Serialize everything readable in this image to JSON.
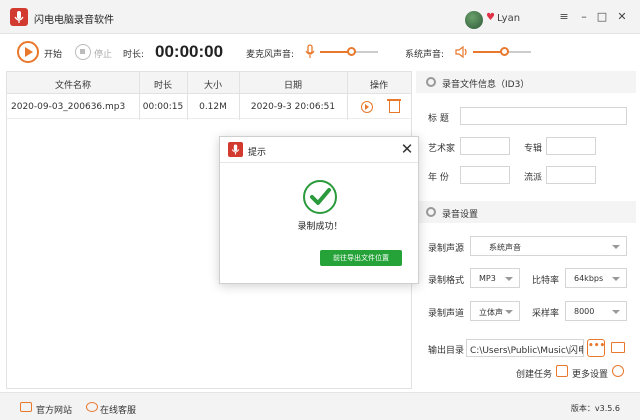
{
  "app": {
    "title": "闪电电脑录音软件",
    "user": "Lyan"
  },
  "window_controls": {
    "menu": "≡",
    "minimize": "–",
    "maximize": "□",
    "close": "✕"
  },
  "toolbar": {
    "start_label": "开始",
    "stop_label": "停止",
    "duration_label": "时长:",
    "duration_value": "00:00:00",
    "mic_label": "麦克风声音:",
    "system_label": "系统声音:",
    "mic_level": 0.55,
    "system_level": 0.55
  },
  "table": {
    "headers": [
      "文件名称",
      "时长",
      "大小",
      "日期",
      "操作"
    ],
    "rows": [
      {
        "name": "2020-09-03_200636.mp3",
        "duration": "00:00:15",
        "size": "0.12M",
        "date": "2020-9-3  20:06:51"
      }
    ]
  },
  "id3": {
    "section_title": "录音文件信息（ID3）",
    "title_label": "标  题",
    "artist_label": "艺术家",
    "album_label": "专辑",
    "year_label": "年  份",
    "genre_label": "流派"
  },
  "settings": {
    "section_title": "录音设置",
    "source_label": "录制声源",
    "source_value": "系统声音",
    "format_label": "录制格式",
    "format_value": "MP3",
    "bitrate_label": "比特率",
    "bitrate_value": "64kbps",
    "channel_label": "录制声道",
    "channel_value": "立体声",
    "samplerate_label": "采样率",
    "samplerate_value": "8000",
    "output_label": "输出目录",
    "output_value": "C:\\Users\\Public\\Music\\闪电",
    "browse_label": "•••",
    "create_task_label": "创建任务",
    "more_settings_label": "更多设置"
  },
  "footer": {
    "website_label": "官方网站",
    "service_label": "在线客服",
    "version": "版本：v3.5.6"
  },
  "dialog": {
    "title": "提示",
    "close": "✕",
    "message": "录制成功！",
    "button_label": "前往导出文件位置"
  },
  "colors": {
    "accent": "#e8782c",
    "brand_red": "#d23a2f",
    "success": "#25a339"
  }
}
